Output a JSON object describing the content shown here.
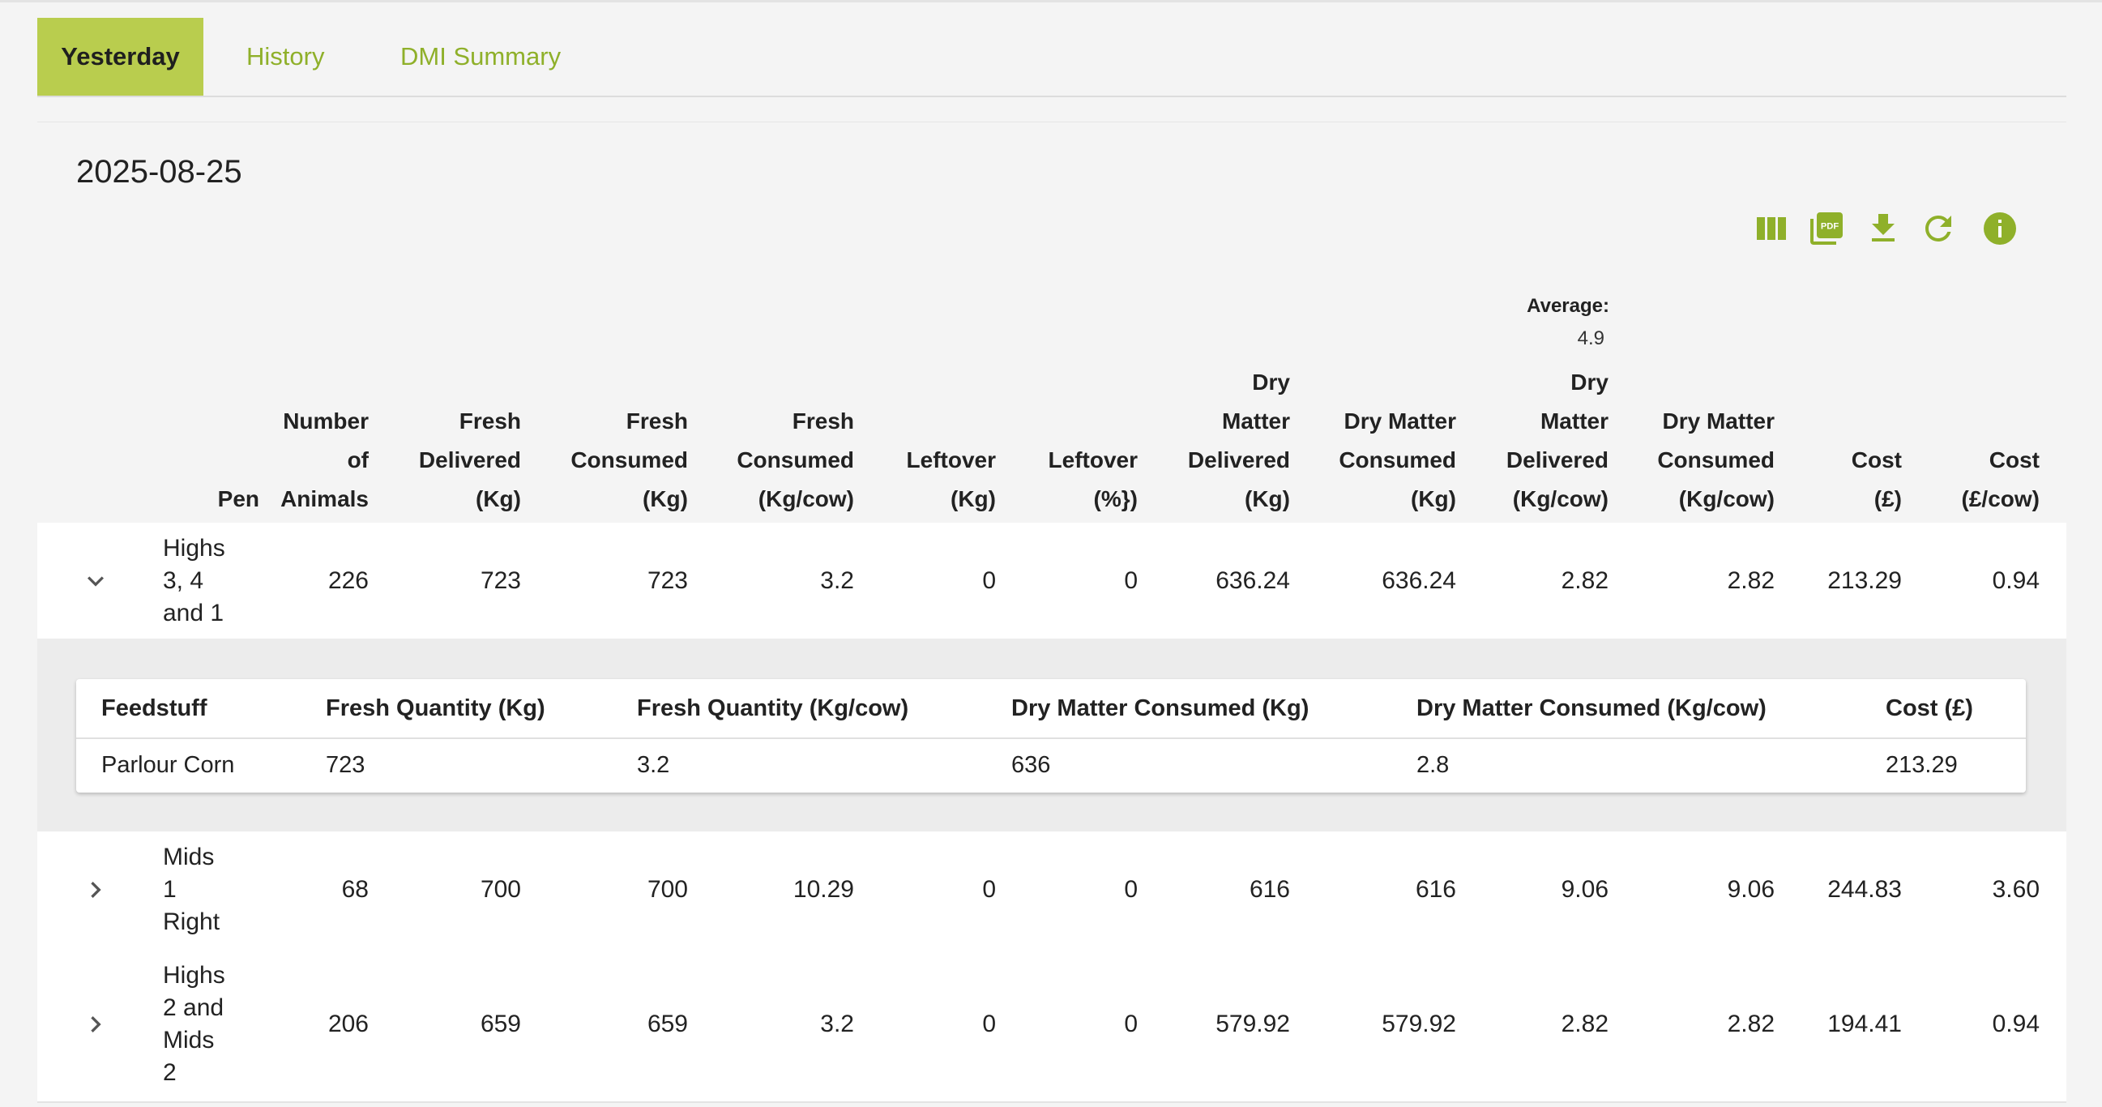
{
  "tabs": [
    {
      "label": "Yesterday"
    },
    {
      "label": "History"
    },
    {
      "label": "DMI Summary"
    }
  ],
  "date": "2025-08-25",
  "toolbar_icons": [
    "columns-icon",
    "pdf-icon",
    "download-icon",
    "refresh-icon",
    "info-icon"
  ],
  "accent_color": "#8fb02a",
  "active_tab_color": "#b9cd4e",
  "table": {
    "average_label": "Average:",
    "average_value": "4.9",
    "columns": [
      {
        "key": "pen",
        "lines": [
          "Pen"
        ]
      },
      {
        "key": "animals",
        "lines": [
          "Number",
          "of",
          "Animals"
        ]
      },
      {
        "key": "fresh_delivered",
        "lines": [
          "Fresh",
          "Delivered",
          "(Kg)"
        ]
      },
      {
        "key": "fresh_consumed",
        "lines": [
          "Fresh",
          "Consumed",
          "(Kg)"
        ]
      },
      {
        "key": "fresh_consumed_cow",
        "lines": [
          "Fresh",
          "Consumed",
          "(Kg/cow)"
        ]
      },
      {
        "key": "leftover_kg",
        "lines": [
          "Leftover",
          "(Kg)"
        ]
      },
      {
        "key": "leftover_pct",
        "lines": [
          "Leftover",
          "(%})"
        ]
      },
      {
        "key": "dm_delivered",
        "lines": [
          "Dry",
          "Matter",
          "Delivered",
          "(Kg)"
        ]
      },
      {
        "key": "dm_consumed",
        "lines": [
          "Dry Matter",
          "Consumed",
          "(Kg)"
        ]
      },
      {
        "key": "dm_delivered_cow",
        "lines": [
          "Dry",
          "Matter",
          "Delivered",
          "(Kg/cow)"
        ]
      },
      {
        "key": "dm_consumed_cow",
        "lines": [
          "Dry Matter",
          "Consumed",
          "(Kg/cow)"
        ]
      },
      {
        "key": "cost",
        "lines": [
          "Cost",
          "(£)"
        ]
      },
      {
        "key": "cost_cow",
        "lines": [
          "Cost",
          "(£/cow)"
        ]
      }
    ],
    "rows": [
      {
        "pen_lines": [
          "Highs",
          "3, 4",
          "and 1"
        ],
        "expanded": true,
        "values": [
          "226",
          "723",
          "723",
          "3.2",
          "0",
          "0",
          "636.24",
          "636.24",
          "2.82",
          "2.82",
          "213.29",
          "0.94"
        ]
      },
      {
        "pen_lines": [
          "Mids",
          "1",
          "Right"
        ],
        "expanded": false,
        "values": [
          "68",
          "700",
          "700",
          "10.29",
          "0",
          "0",
          "616",
          "616",
          "9.06",
          "9.06",
          "244.83",
          "3.60"
        ]
      },
      {
        "pen_lines": [
          "Highs",
          "2 and",
          "Mids",
          "2"
        ],
        "expanded": false,
        "values": [
          "206",
          "659",
          "659",
          "3.2",
          "0",
          "0",
          "579.92",
          "579.92",
          "2.82",
          "2.82",
          "194.41",
          "0.94"
        ]
      }
    ]
  },
  "detail": {
    "headers": [
      "Feedstuff",
      "Fresh Quantity (Kg)",
      "Fresh Quantity (Kg/cow)",
      "Dry Matter Consumed (Kg)",
      "Dry Matter Consumed (Kg/cow)",
      "Cost (£)"
    ],
    "rows": [
      [
        "Parlour Corn",
        "723",
        "3.2",
        "636",
        "2.8",
        "213.29"
      ]
    ]
  }
}
